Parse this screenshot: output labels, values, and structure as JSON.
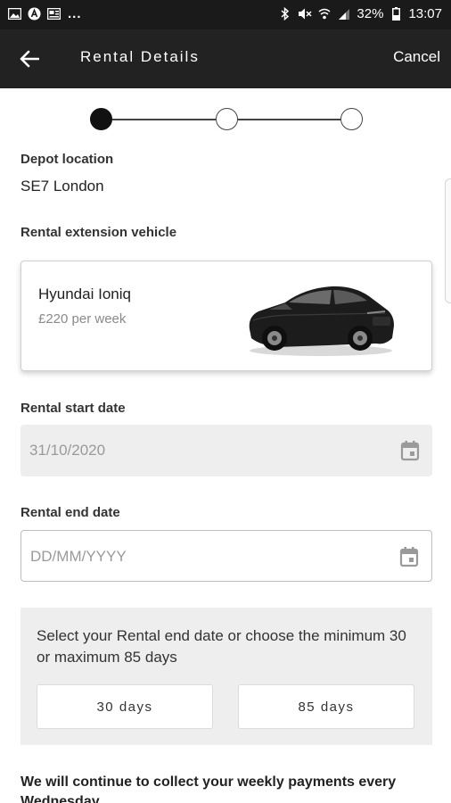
{
  "status_bar": {
    "left_icons": [
      "gallery-icon",
      "app-a-icon",
      "news-icon"
    ],
    "more": "...",
    "battery": "32%",
    "time": "13:07"
  },
  "app_bar": {
    "title": "Rental Details",
    "cancel_label": "Cancel"
  },
  "stepper": {
    "total_steps": 3,
    "current_step": 1
  },
  "depot": {
    "label": "Depot location",
    "value": "SE7 London"
  },
  "vehicle": {
    "label": "Rental extension vehicle",
    "name": "Hyundai Ioniq",
    "price": "£220 per week"
  },
  "start_date": {
    "label": "Rental start date",
    "value": "31/10/2020"
  },
  "end_date": {
    "label": "Rental end date",
    "placeholder": "DD/MM/YYYY"
  },
  "duration": {
    "prompt": "Select your Rental end date or choose the minimum 30 or maximum 85 days",
    "min_label": "30 days",
    "max_label": "85 days"
  },
  "footer": {
    "text": "We will continue to collect your weekly payments every Wednesday."
  },
  "colors": {
    "app_bar": "#222222",
    "status_bar": "#1a1a1a",
    "field_disabled": "#eeeeee"
  }
}
